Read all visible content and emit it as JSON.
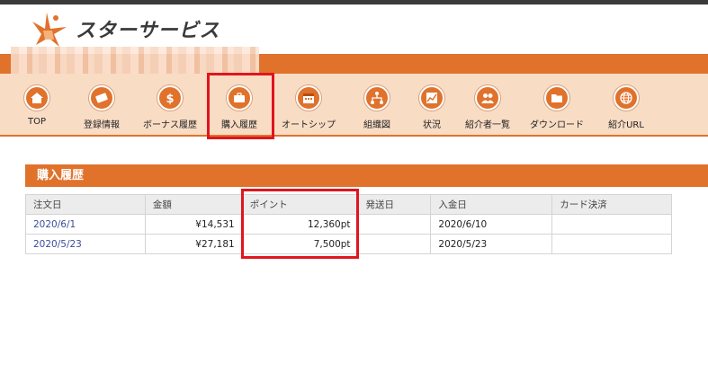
{
  "brand": {
    "name": "スターサービス"
  },
  "nav": {
    "items": [
      {
        "label": "TOP",
        "icon": "home-icon"
      },
      {
        "label": "登録情報",
        "icon": "id-card-icon"
      },
      {
        "label": "ボーナス履歴",
        "icon": "dollar-icon"
      },
      {
        "label": "購入履歴",
        "icon": "briefcase-icon"
      },
      {
        "label": "オートシップ",
        "icon": "calendar-icon"
      },
      {
        "label": "組織図",
        "icon": "org-chart-icon"
      },
      {
        "label": "状況",
        "icon": "line-chart-icon"
      },
      {
        "label": "紹介者一覧",
        "icon": "users-icon"
      },
      {
        "label": "ダウンロード",
        "icon": "folder-download-icon"
      },
      {
        "label": "紹介URL",
        "icon": "globe-icon"
      }
    ],
    "active": "購入履歴"
  },
  "section": {
    "title": "購入履歴"
  },
  "table": {
    "headers": [
      "注文日",
      "金額",
      "ポイント",
      "発送日",
      "入金日",
      "カード決済"
    ],
    "rows": [
      [
        "2020/6/1",
        "¥14,531",
        "12,360pt",
        "",
        "2020/6/10",
        ""
      ],
      [
        "2020/5/23",
        "¥27,181",
        "7,500pt",
        "",
        "2020/5/23",
        ""
      ]
    ]
  },
  "colors": {
    "accent": "#e0722c",
    "nav_bg": "#f9dcc4",
    "highlight": "#e0151d",
    "link": "#3b4b9a"
  }
}
